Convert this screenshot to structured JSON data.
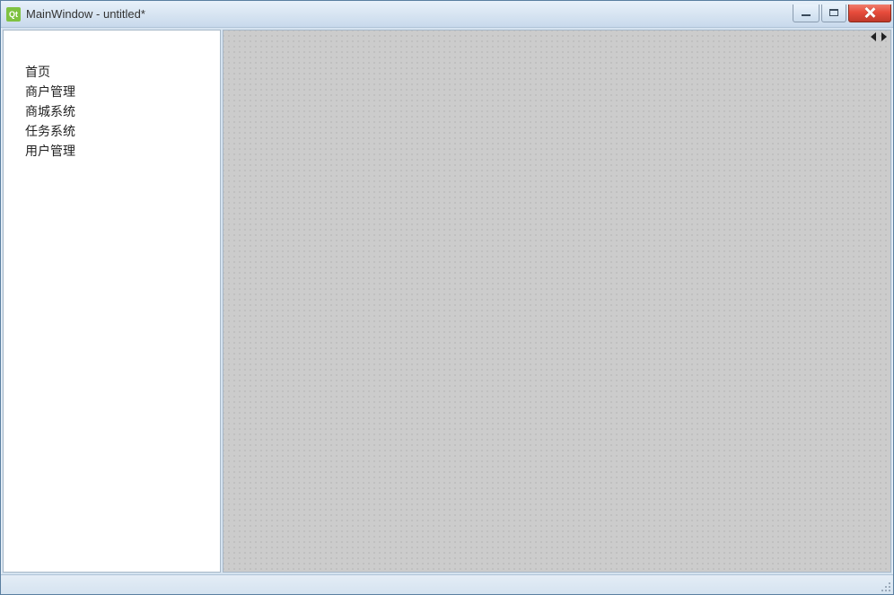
{
  "titlebar": {
    "app_icon_label": "Qt",
    "title": "MainWindow - untitled*"
  },
  "sidebar": {
    "items": [
      {
        "label": "首页"
      },
      {
        "label": "商户管理"
      },
      {
        "label": "商城系统"
      },
      {
        "label": "任务系统"
      },
      {
        "label": "用户管理"
      }
    ]
  }
}
